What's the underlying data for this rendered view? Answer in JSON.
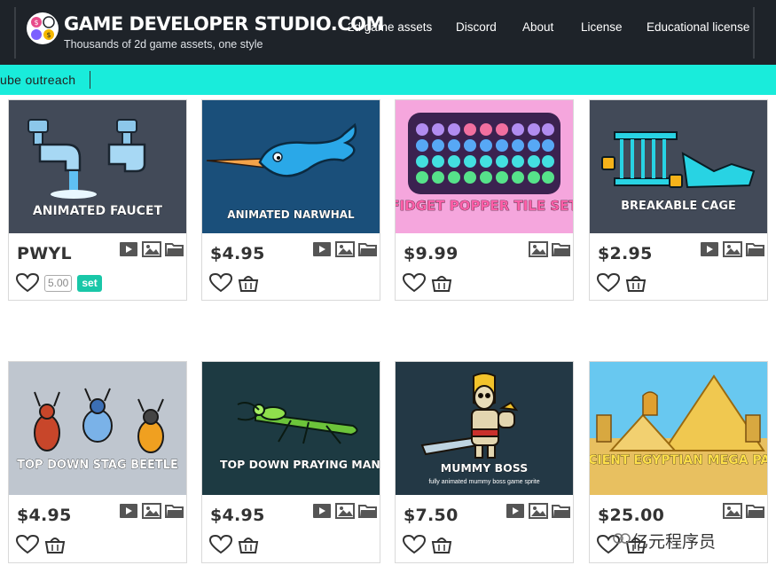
{
  "header": {
    "brand_title": "GAME DEVELOPER STUDIO.COM",
    "brand_tagline": "Thousands of 2d game assets, one style",
    "nav": [
      "2d game assets",
      "Discord",
      "About",
      "License",
      "Educational license"
    ]
  },
  "ticker": {
    "text": "ube outreach"
  },
  "products": [
    {
      "caption": "ANIMATED FAUCET",
      "price": "PWYL",
      "rating": "5.00",
      "set_label": "set"
    },
    {
      "caption": "ANIMATED NARWHAL",
      "price": "$4.95"
    },
    {
      "caption": "FIDGET POPPER TILE SET",
      "price": "$9.99"
    },
    {
      "caption": "BREAKABLE CAGE",
      "price": "$2.95"
    },
    {
      "caption": "TOP DOWN STAG BEETLE",
      "price": "$4.95"
    },
    {
      "caption": "TOP DOWN PRAYING MANTIS",
      "price": "$4.95"
    },
    {
      "caption": "MUMMY BOSS",
      "subcaption": "fully animated mummy boss game sprite",
      "price": "$7.50"
    },
    {
      "caption": "ANCIENT EGYPTIAN MEGA PACK",
      "price": "$25.00"
    }
  ],
  "watermark": "亿元程序员",
  "colors": {
    "header_bg": "#1e2329",
    "ticker_bg": "#19ecdb",
    "set_button": "#19c7a8"
  }
}
